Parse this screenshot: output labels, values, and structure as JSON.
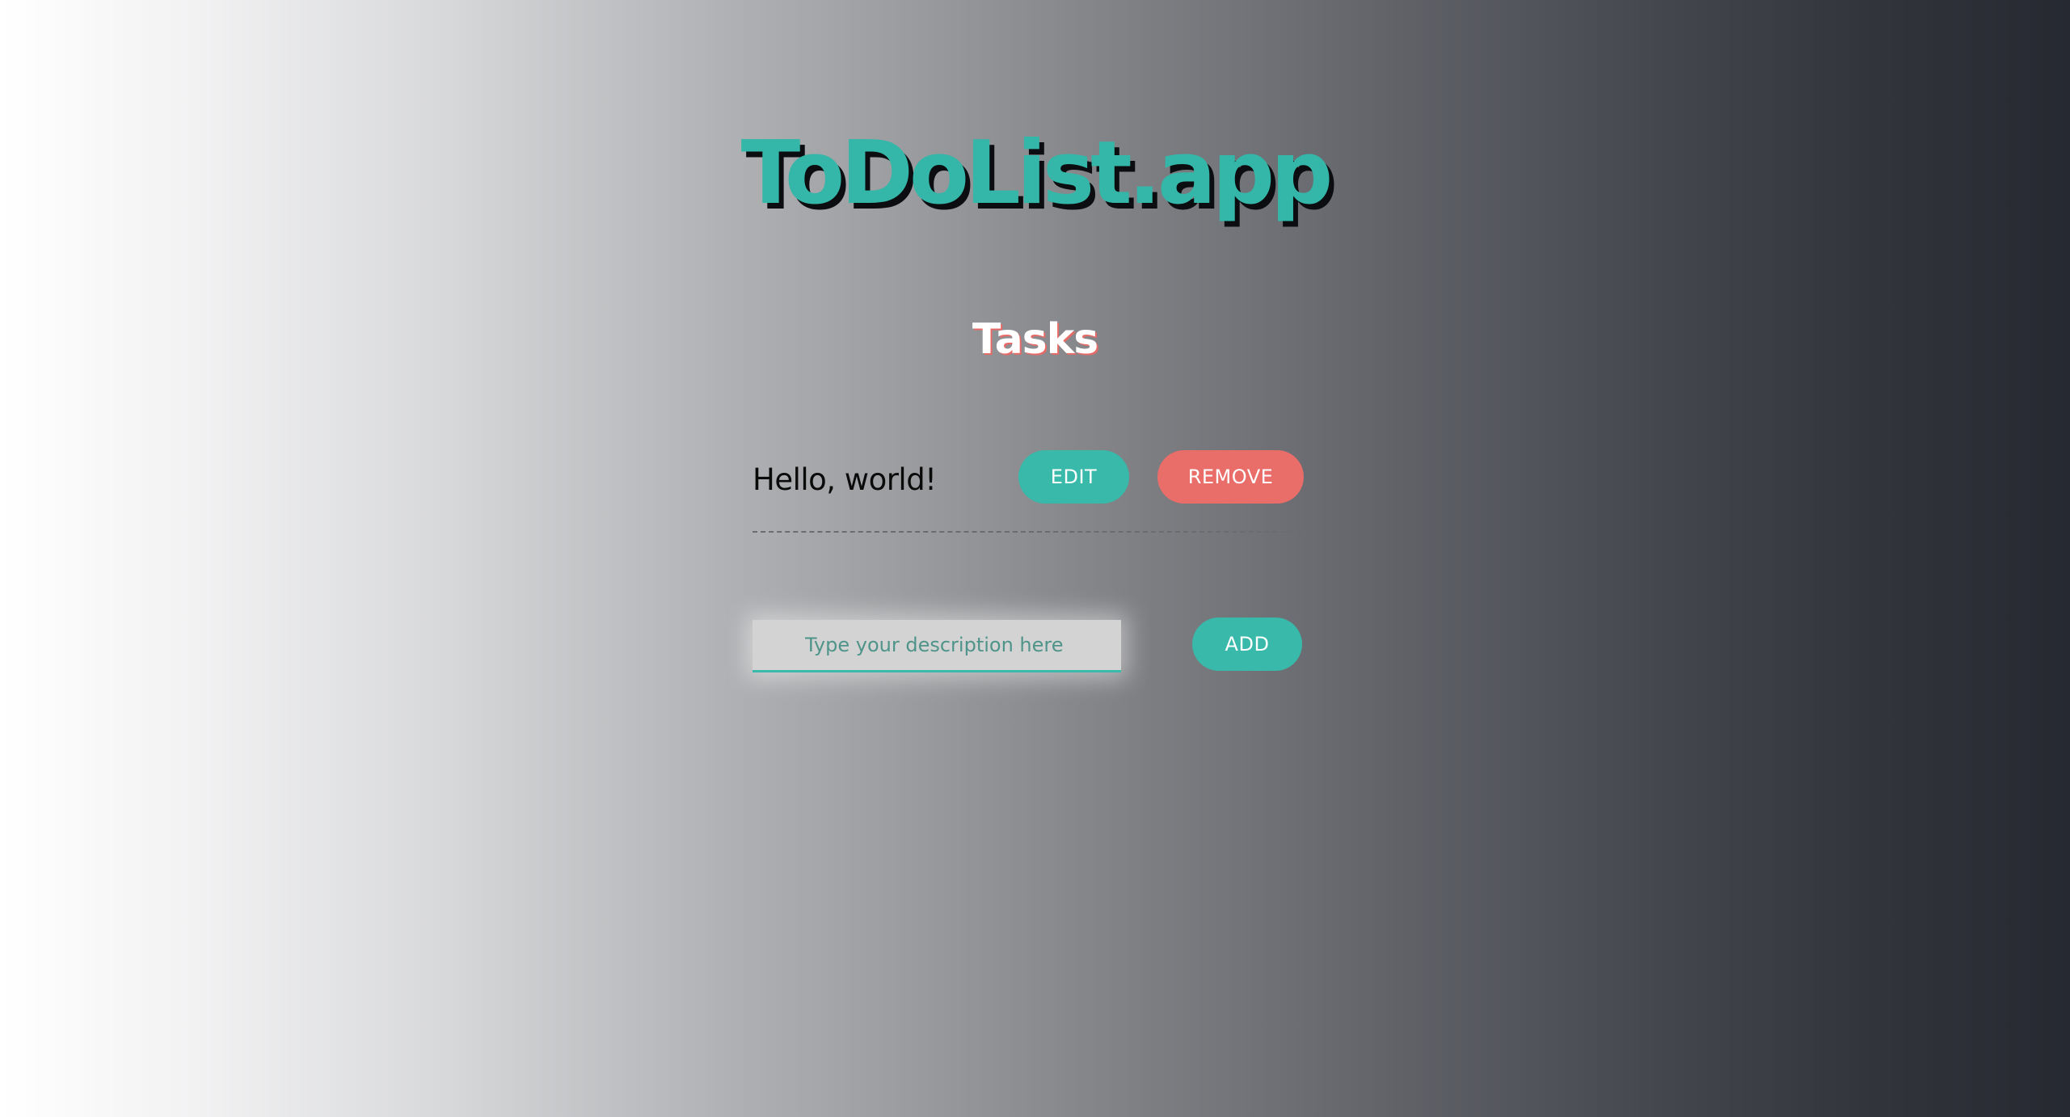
{
  "header": {
    "app_title": "ToDoList.app"
  },
  "tasks_section": {
    "title": "Tasks",
    "items": [
      {
        "text": "Hello, world!",
        "edit_label": "EDIT",
        "remove_label": "REMOVE"
      }
    ]
  },
  "add_form": {
    "placeholder": "Type your description here",
    "value": "",
    "add_label": "ADD"
  },
  "colors": {
    "accent": "#38b9aa",
    "danger": "#e96d69",
    "title_shadow": "#0c0d10"
  }
}
